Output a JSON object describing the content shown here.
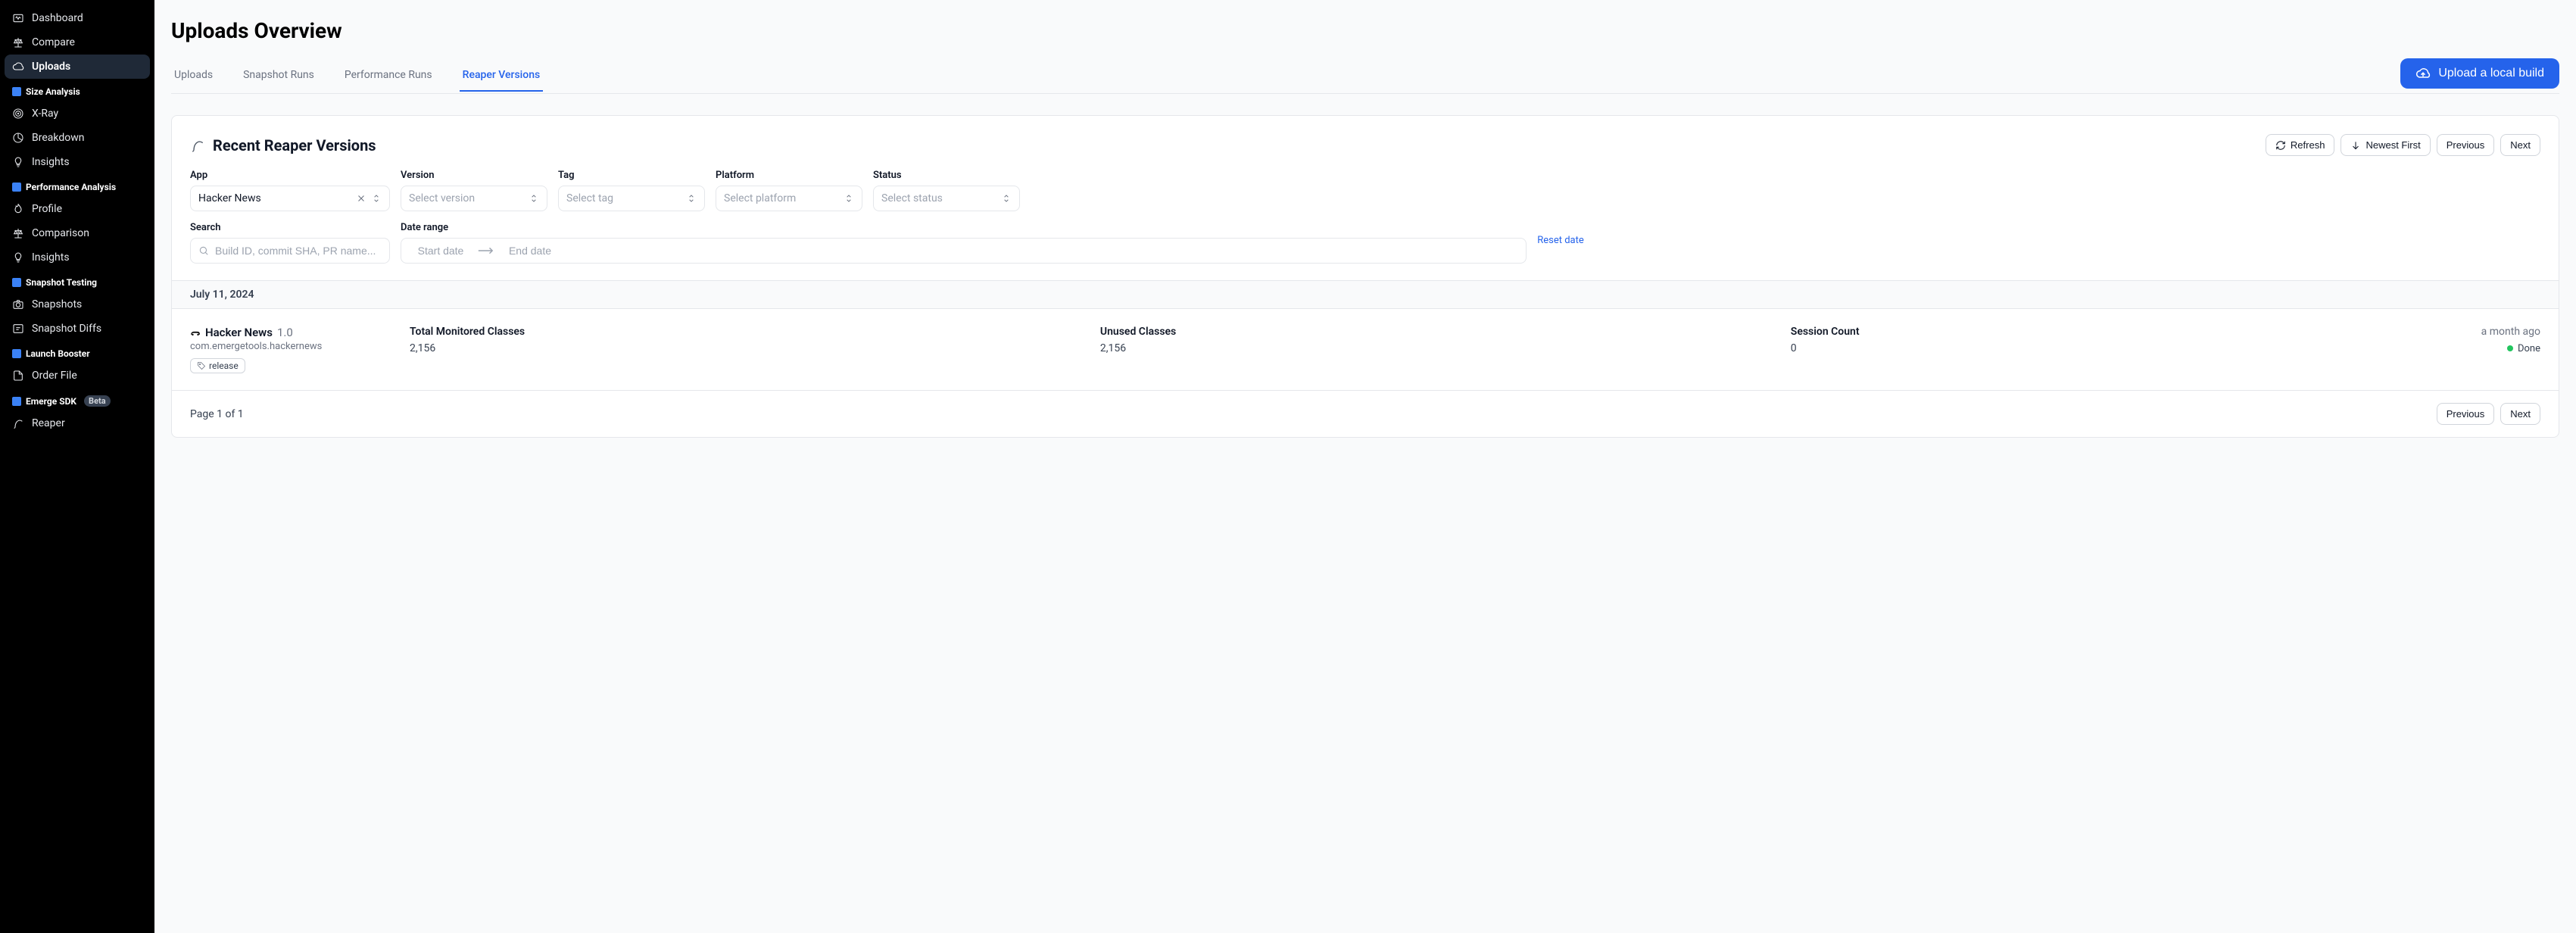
{
  "sidebar": {
    "top": [
      {
        "label": "Dashboard",
        "icon": "activity"
      },
      {
        "label": "Compare",
        "icon": "balance"
      },
      {
        "label": "Uploads",
        "icon": "cloud",
        "active": true
      }
    ],
    "sections": [
      {
        "title": "Size Analysis",
        "items": [
          {
            "label": "X-Ray",
            "icon": "target"
          },
          {
            "label": "Breakdown",
            "icon": "pie"
          },
          {
            "label": "Insights",
            "icon": "bulb"
          }
        ]
      },
      {
        "title": "Performance Analysis",
        "items": [
          {
            "label": "Profile",
            "icon": "flame"
          },
          {
            "label": "Comparison",
            "icon": "balance"
          },
          {
            "label": "Insights",
            "icon": "bulb"
          }
        ]
      },
      {
        "title": "Snapshot Testing",
        "items": [
          {
            "label": "Snapshots",
            "icon": "camera"
          },
          {
            "label": "Snapshot Diffs",
            "icon": "diff"
          }
        ]
      },
      {
        "title": "Launch Booster",
        "items": [
          {
            "label": "Order File",
            "icon": "file"
          }
        ]
      },
      {
        "title": "Emerge SDK",
        "badge": "Beta",
        "items": [
          {
            "label": "Reaper",
            "icon": "reaper"
          }
        ]
      }
    ]
  },
  "page_title": "Uploads Overview",
  "tabs": [
    {
      "label": "Uploads"
    },
    {
      "label": "Snapshot Runs"
    },
    {
      "label": "Performance Runs"
    },
    {
      "label": "Reaper Versions",
      "active": true
    }
  ],
  "upload_button": "Upload a local build",
  "panel": {
    "title": "Recent Reaper Versions",
    "refresh": "Refresh",
    "sort": "Newest First",
    "prev": "Previous",
    "next": "Next"
  },
  "filters": {
    "app": {
      "label": "App",
      "value": "Hacker News"
    },
    "version": {
      "label": "Version",
      "placeholder": "Select version"
    },
    "tag": {
      "label": "Tag",
      "placeholder": "Select tag"
    },
    "platform": {
      "label": "Platform",
      "placeholder": "Select platform"
    },
    "status": {
      "label": "Status",
      "placeholder": "Select status"
    },
    "search": {
      "label": "Search",
      "placeholder": "Build ID, commit SHA, PR name..."
    },
    "date": {
      "label": "Date range",
      "start_placeholder": "Start date",
      "end_placeholder": "End date"
    },
    "reset": "Reset date"
  },
  "group_date": "July 11, 2024",
  "row": {
    "app_name": "Hacker News",
    "app_version": "1.0",
    "bundle_id": "com.emergetools.hackernews",
    "tag": "release",
    "monitored_label": "Total Monitored Classes",
    "monitored_value": "2,156",
    "unused_label": "Unused Classes",
    "unused_value": "2,156",
    "session_label": "Session Count",
    "session_value": "0",
    "time_ago": "a month ago",
    "status": "Done"
  },
  "footer": {
    "page_info": "Page 1 of 1",
    "prev": "Previous",
    "next": "Next"
  }
}
